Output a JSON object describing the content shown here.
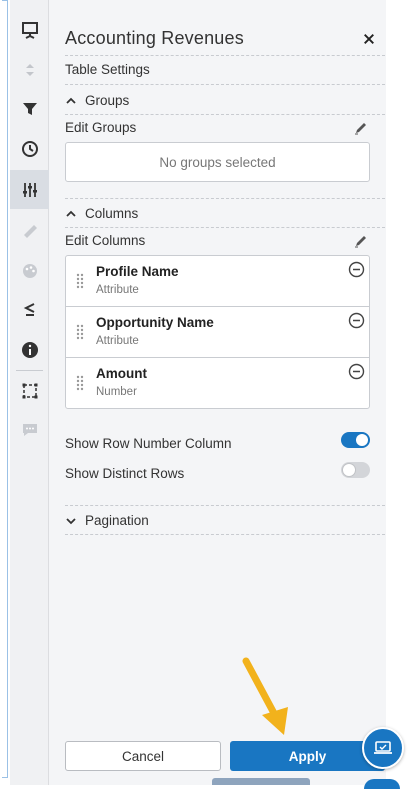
{
  "panel": {
    "title": "Accounting Revenues",
    "subtitle": "Table Settings"
  },
  "groups": {
    "section_label": "Groups",
    "edit_label": "Edit Groups",
    "empty_text": "No groups selected"
  },
  "columns": {
    "section_label": "Columns",
    "edit_label": "Edit Columns",
    "items": [
      {
        "name": "Profile Name",
        "type": "Attribute"
      },
      {
        "name": "Opportunity Name",
        "type": "Attribute"
      },
      {
        "name": "Amount",
        "type": "Number"
      }
    ]
  },
  "options": {
    "show_row_number": {
      "label": "Show Row Number Column",
      "enabled": true
    },
    "show_distinct_rows": {
      "label": "Show Distinct Rows",
      "enabled": false
    }
  },
  "pagination": {
    "section_label": "Pagination"
  },
  "buttons": {
    "cancel": "Cancel",
    "apply": "Apply"
  },
  "colors": {
    "accent": "#1976c2",
    "arrow": "#f2b21c",
    "panel_bg": "#f4f5f7"
  },
  "rail_icons": [
    "presentation-icon",
    "sort-icon",
    "filter-icon",
    "clock-icon",
    "sliders-icon",
    "ruler-icon",
    "palette-icon",
    "less-equal-icon",
    "info-icon",
    "select-box-icon",
    "comment-icon"
  ]
}
